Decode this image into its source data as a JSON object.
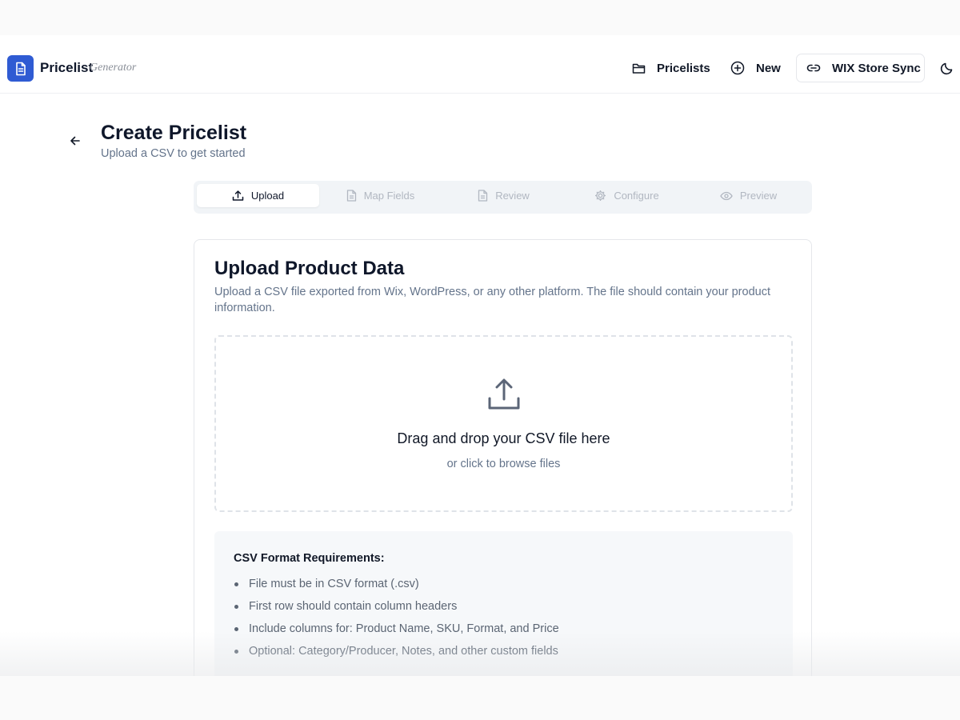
{
  "header": {
    "brand": "Pricelist",
    "brand_sub": "Generator",
    "nav": {
      "pricelists": "Pricelists",
      "new": "New",
      "wix_sync": "WIX Store Sync"
    }
  },
  "page": {
    "title": "Create Pricelist",
    "subtitle": "Upload a CSV to get started"
  },
  "steps": [
    {
      "label": "Upload",
      "icon": "upload-icon",
      "active": true
    },
    {
      "label": "Map Fields",
      "icon": "file-icon",
      "active": false
    },
    {
      "label": "Review",
      "icon": "file-icon",
      "active": false
    },
    {
      "label": "Configure",
      "icon": "gear-icon",
      "active": false
    },
    {
      "label": "Preview",
      "icon": "eye-icon",
      "active": false
    }
  ],
  "upload": {
    "title": "Upload Product Data",
    "description": "Upload a CSV file exported from Wix, WordPress, or any other platform. The file should contain your product information.",
    "drop_title": "Drag and drop your CSV file here",
    "drop_sub": "or click to browse files"
  },
  "requirements": {
    "title": "CSV Format Requirements:",
    "items": [
      "File must be in CSV format (.csv)",
      "First row should contain column headers",
      "Include columns for: Product Name, SKU, Format, and Price",
      "Optional: Category/Producer, Notes, and other custom fields"
    ]
  },
  "colors": {
    "brand": "#2f5bd3",
    "text": "#0f172a",
    "muted": "#64748b",
    "step_inactive": "#b1b7c1"
  }
}
